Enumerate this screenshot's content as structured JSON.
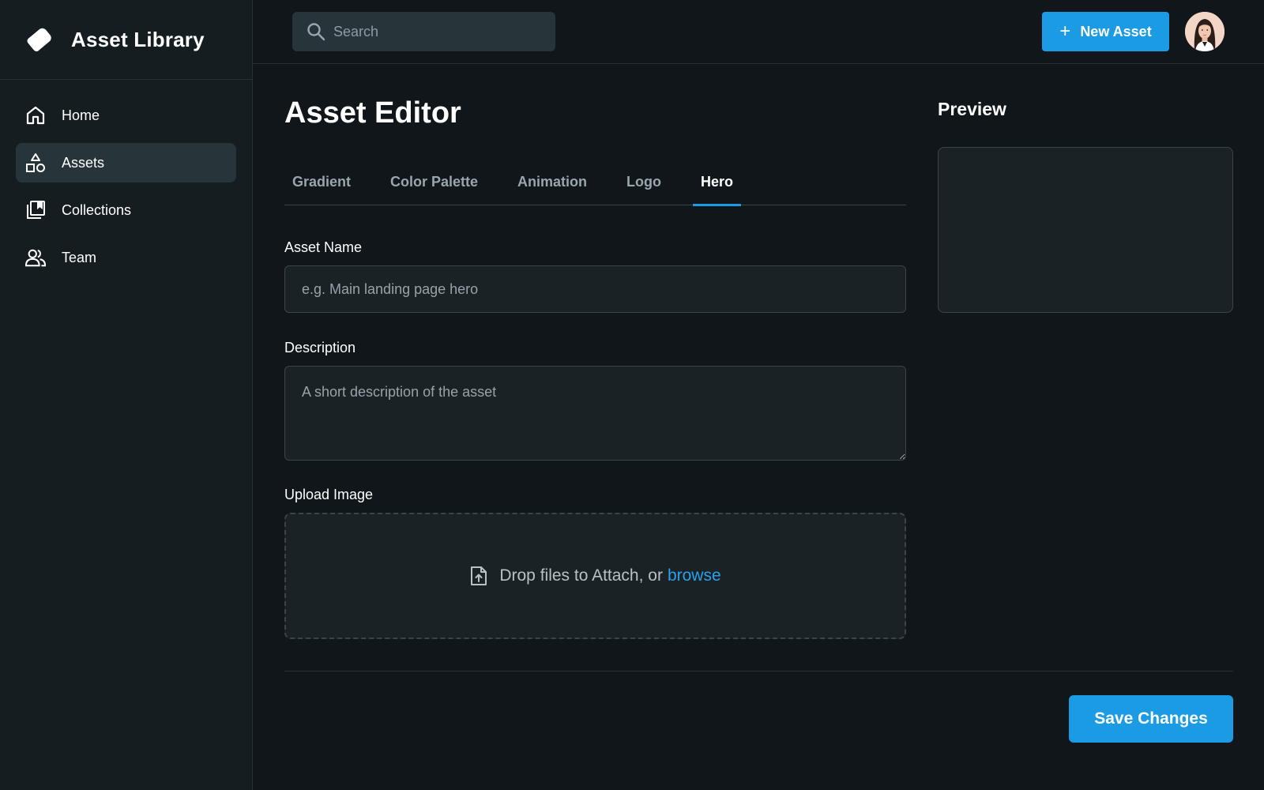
{
  "app": {
    "title": "Asset Library"
  },
  "sidebar": {
    "items": [
      {
        "label": "Home",
        "icon": "home-icon",
        "active": false
      },
      {
        "label": "Assets",
        "icon": "shapes-icon",
        "active": true
      },
      {
        "label": "Collections",
        "icon": "collections-icon",
        "active": false
      },
      {
        "label": "Team",
        "icon": "team-icon",
        "active": false
      }
    ]
  },
  "topbar": {
    "search_placeholder": "Search",
    "new_asset_label": "New Asset"
  },
  "main": {
    "title": "Asset Editor",
    "tabs": [
      {
        "label": "Gradient",
        "active": false
      },
      {
        "label": "Color Palette",
        "active": false
      },
      {
        "label": "Animation",
        "active": false
      },
      {
        "label": "Logo",
        "active": false
      },
      {
        "label": "Hero",
        "active": true
      }
    ],
    "form": {
      "name_label": "Asset Name",
      "name_placeholder": "e.g. Main landing page hero",
      "name_value": "",
      "description_label": "Description",
      "description_placeholder": "A short description of the asset",
      "description_value": "",
      "upload_label": "Upload Image",
      "upload_text": "Drop files to Attach, or",
      "upload_link": "browse"
    },
    "save_label": "Save Changes"
  },
  "preview": {
    "title": "Preview"
  },
  "colors": {
    "accent": "#1a9be4",
    "background": "#10161a",
    "sidebar": "#161d21",
    "surface": "#1a2226"
  }
}
